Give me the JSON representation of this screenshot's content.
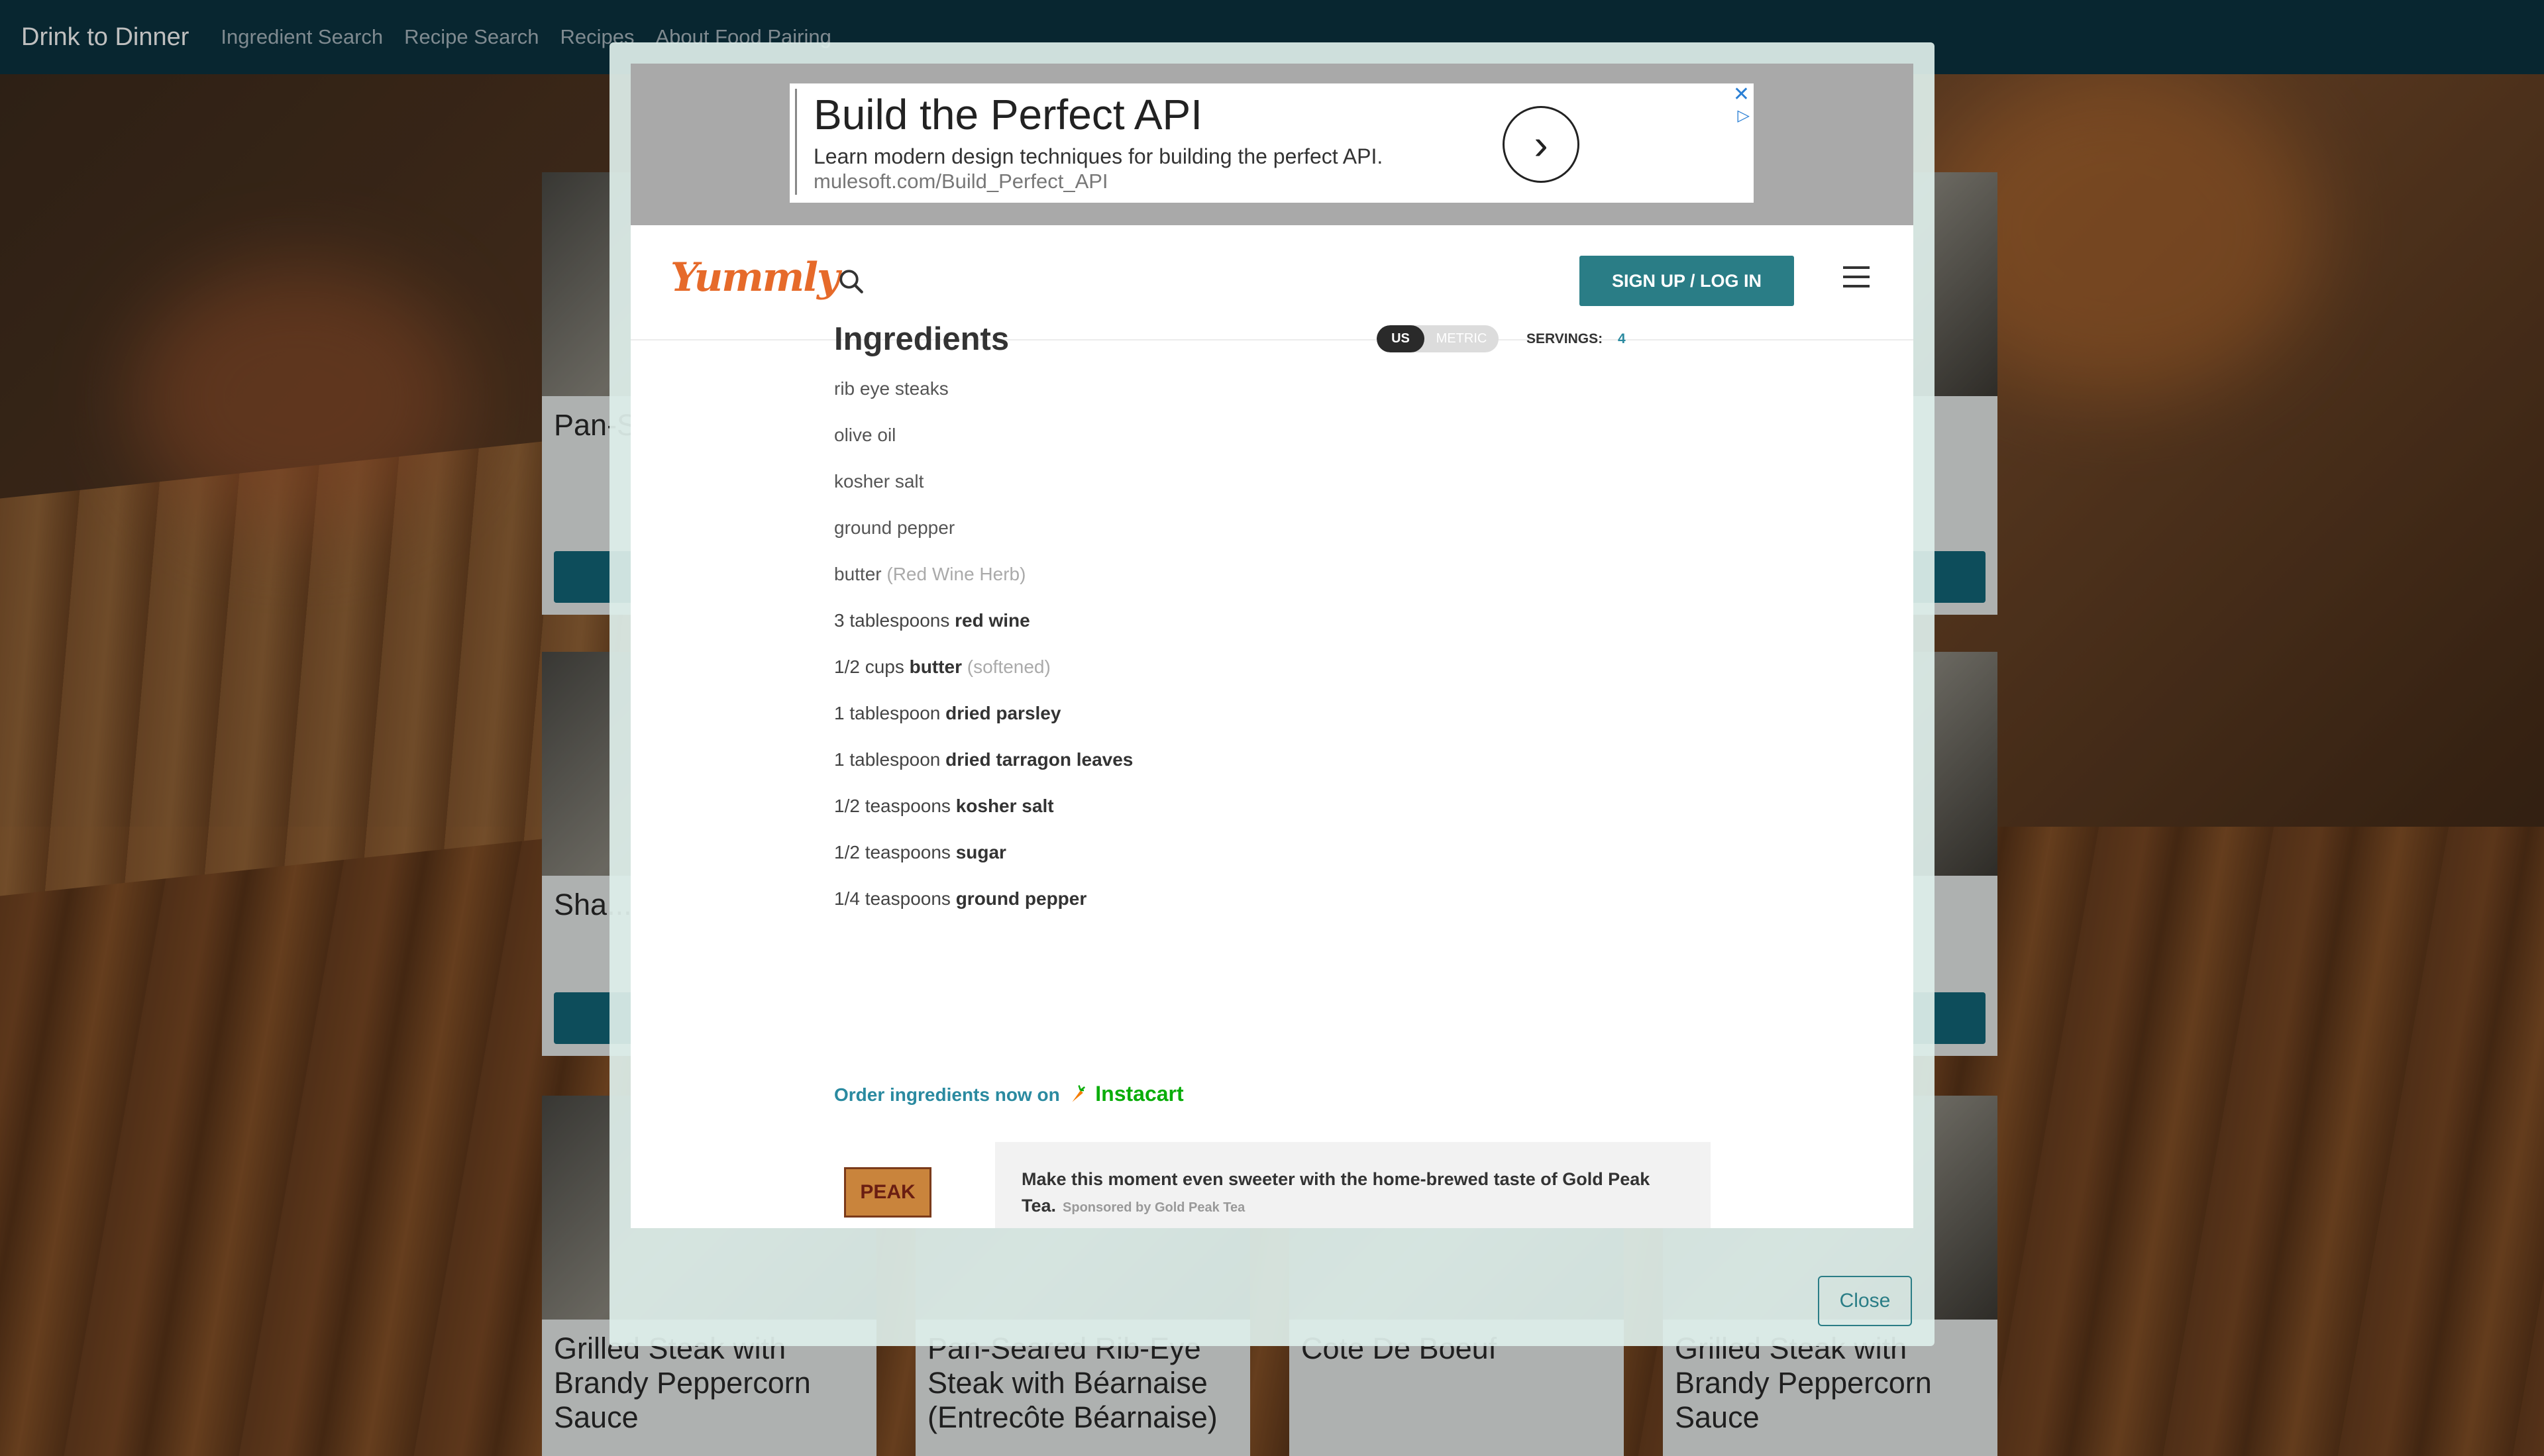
{
  "nav": {
    "brand": "Drink to Dinner",
    "links": [
      "Ingredient Search",
      "Recipe Search",
      "Recipes",
      "About Food Pairing"
    ]
  },
  "cards": [
    {
      "title": "Pan-S... Steak (Entr..."
    },
    {
      "title": "Sha..."
    },
    {
      "title": "Grilled Steak with Brandy Peppercorn Sauce"
    },
    {
      "title": "Pan-Seared Rib-Eye Steak with Béarnaise (Entrecôte Béarnaise)"
    },
    {
      "title": "Cote De Boeuf"
    },
    {
      "title": "Grilled Steak with Brandy Peppercorn Sauce"
    }
  ],
  "ad": {
    "title": "Build the Perfect API",
    "description": "Learn modern design techniques for building the perfect API.",
    "url": "mulesoft.com/Build_Perfect_API"
  },
  "yummly": {
    "logo": "Yummly",
    "signup_label": "SIGN UP / LOG IN"
  },
  "ingredients": {
    "title": "Ingredients",
    "units": {
      "selected": "US",
      "other": "METRIC"
    },
    "servings_label": "SERVINGS:",
    "servings_value": "4",
    "items": [
      {
        "qty": "",
        "name": "rib eye steaks",
        "note": ""
      },
      {
        "qty": "",
        "name": "olive oil",
        "note": ""
      },
      {
        "qty": "",
        "name": "kosher salt",
        "note": ""
      },
      {
        "qty": "",
        "name": "ground pepper",
        "note": ""
      },
      {
        "qty": "",
        "name": "butter",
        "note": "(Red Wine Herb)"
      },
      {
        "qty": "3 tablespoons",
        "name": "red wine",
        "note": ""
      },
      {
        "qty": "1/2 cups",
        "name": "butter",
        "note": "(softened)"
      },
      {
        "qty": "1 tablespoon",
        "name": "dried parsley",
        "note": ""
      },
      {
        "qty": "1 tablespoon",
        "name": "dried tarragon leaves",
        "note": ""
      },
      {
        "qty": "1/2 teaspoons",
        "name": "kosher salt",
        "note": ""
      },
      {
        "qty": "1/2 teaspoons",
        "name": "sugar",
        "note": ""
      },
      {
        "qty": "1/4 teaspoons",
        "name": "ground pepper",
        "note": ""
      }
    ],
    "order_text": "Order ingredients now on",
    "order_brand": "Instacart"
  },
  "sponsor": {
    "logo_text": "PEAK",
    "message": "Make this moment even sweeter with the home-brewed taste of Gold Peak Tea.",
    "by": "Sponsored by Gold Peak Tea"
  },
  "modal": {
    "close_label": "Close"
  },
  "colors": {
    "navbar": "#0b3340",
    "accent": "#2a7d86",
    "yummly_orange": "#e66a2a",
    "instacart_green": "#0aad0a"
  }
}
